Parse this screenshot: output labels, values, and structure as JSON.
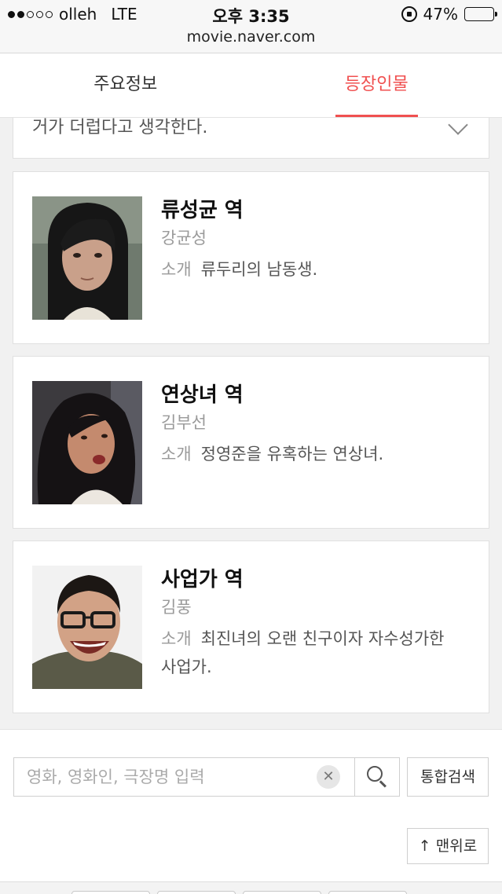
{
  "status_bar": {
    "carrier": "olleh",
    "network": "LTE",
    "time": "오후 3:35",
    "url": "movie.naver.com",
    "battery": "47%",
    "battery_level": 0.47,
    "battery_color": "#f4c41b"
  },
  "tabs": [
    {
      "label": "주요정보",
      "active": false
    },
    {
      "label": "등장인물",
      "active": true
    }
  ],
  "accent_color": "#f05050",
  "collapsed_card": {
    "text": "거가 더럽다고 생각한다.",
    "icon": "chevron-down-icon"
  },
  "characters": [
    {
      "role": "류성균 역",
      "actor": "강균성",
      "intro_label": "소개",
      "intro": "류두리의 남동생."
    },
    {
      "role": "연상녀 역",
      "actor": "김부선",
      "intro_label": "소개",
      "intro": "정영준을 유혹하는 연상녀."
    },
    {
      "role": "사업가 역",
      "actor": "김풍",
      "intro_label": "소개",
      "intro": "최진녀의 오랜 친구이자 자수성가한 사업가."
    }
  ],
  "search": {
    "placeholder": "영화, 영화인, 극장명 입력",
    "value": "",
    "clear_icon": "close-icon",
    "search_icon": "search-icon",
    "integrated_label": "통합검색"
  },
  "top_button": {
    "label": "↑ 맨위로"
  }
}
